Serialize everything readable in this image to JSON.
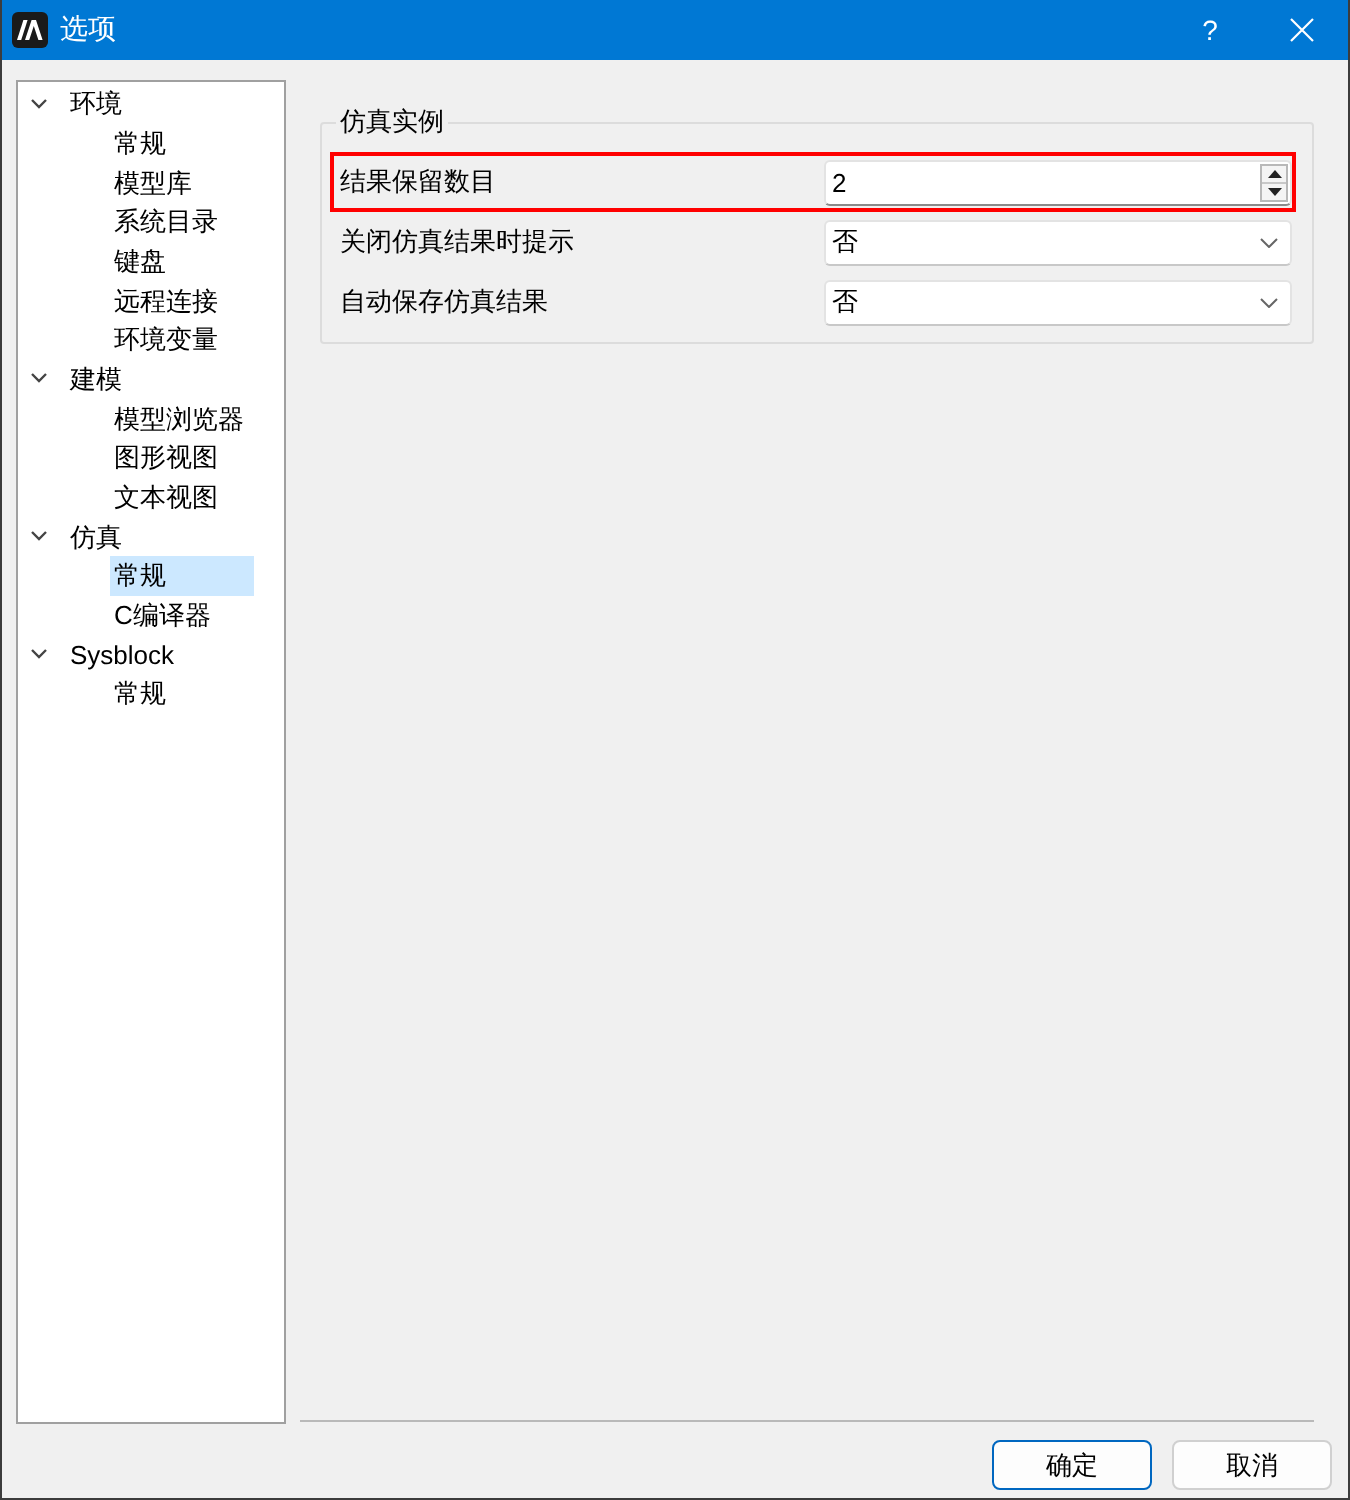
{
  "window": {
    "title": "选项",
    "help": "?"
  },
  "tree": [
    {
      "label": "环境",
      "expanded": true,
      "selected": false,
      "children": [
        {
          "label": "常规",
          "selected": false
        },
        {
          "label": "模型库",
          "selected": false
        },
        {
          "label": "系统目录",
          "selected": false
        },
        {
          "label": "键盘",
          "selected": false
        },
        {
          "label": "远程连接",
          "selected": false
        },
        {
          "label": "环境变量",
          "selected": false
        }
      ]
    },
    {
      "label": "建模",
      "expanded": true,
      "selected": false,
      "children": [
        {
          "label": "模型浏览器",
          "selected": false
        },
        {
          "label": "图形视图",
          "selected": false
        },
        {
          "label": "文本视图",
          "selected": false
        }
      ]
    },
    {
      "label": "仿真",
      "expanded": true,
      "selected": false,
      "children": [
        {
          "label": "常规",
          "selected": true
        },
        {
          "label": "C编译器",
          "selected": false
        }
      ]
    },
    {
      "label": "Sysblock",
      "expanded": true,
      "selected": false,
      "children": [
        {
          "label": "常规",
          "selected": false
        }
      ]
    }
  ],
  "group": {
    "title": "仿真实例",
    "rows": [
      {
        "kind": "spinbox",
        "label": "结果保留数目",
        "value": "2",
        "highlighted": true
      },
      {
        "kind": "dropdown",
        "label": "关闭仿真结果时提示",
        "value": "否",
        "highlighted": false
      },
      {
        "kind": "dropdown",
        "label": "自动保存仿真结果",
        "value": "否",
        "highlighted": false
      }
    ]
  },
  "buttons": [
    {
      "label": "确定",
      "default": true
    },
    {
      "label": "取消",
      "default": false
    }
  ]
}
